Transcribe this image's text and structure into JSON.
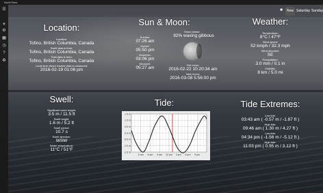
{
  "window": {
    "title": "NorthTides"
  },
  "nav": {
    "icons": [
      "menu-icon",
      "sun-icon",
      "settings-icon",
      "calendar-icon",
      "clock-icon",
      "help-icon",
      "share-icon"
    ],
    "glyphs": [
      "☰",
      "☀",
      "⚙",
      "▦",
      "◷",
      "?",
      "♻"
    ]
  },
  "toolbar": {
    "stop_glyph": "■",
    "days": [
      {
        "label": "Now",
        "active": true
      },
      {
        "label": "Saturday",
        "active": false
      },
      {
        "label": "Sunday",
        "active": false
      }
    ]
  },
  "location": {
    "heading": "Location:",
    "location_label": "Location:",
    "location_value": "Tofino, British Columbia, Canada",
    "swell_from_label": "Swell data is from:",
    "swell_from_value": "Tofino, British Columbia, Canada",
    "tide_from_label": "Tidal data is from:",
    "tide_from_value": "Tofino, British Columbia, Canada",
    "measured_label": "Local time where marine data is measured:",
    "measured_value": "2016-02-19 01:06 pm"
  },
  "sunmoon": {
    "heading": "Sun & Moon:",
    "sunrise_label": "Sunrise:",
    "sunrise_value": "07:26 am",
    "sunset_label": "Sunset:",
    "sunset_value": "05:50 pm",
    "moonrise_label": "Moonrise:",
    "moonrise_value": "03:06 pm",
    "moonset_label": "Moonset:",
    "moonset_value": "05:27 am",
    "phase_label": "Moon phase:",
    "phase_value": "92%  waxing gibbous",
    "fullmoon_label": "Full moon:",
    "fullmoon_value": "2016-02-22 10:20:34 am",
    "newmoon_label": "New moon:",
    "newmoon_value": "2016-03-08 5:56:00 pm"
  },
  "weather": {
    "heading": "Weather:",
    "temp_label": "Temperature:",
    "temp_value": "8°C / 47°F",
    "wind_speed_label": "Wind speed:",
    "wind_speed_value": "52 kmph / 32.3 mph",
    "wind_dir_label": "Wind direction:",
    "wind_dir_value": "SE",
    "precip_label": "Precipitation:",
    "precip_value": "3.0 mm / 0.1 in",
    "visibility_label": "Visibility:",
    "visibility_value": "8 km / 5.0 mi"
  },
  "swell": {
    "heading": "Swell:",
    "wave_label": "Significant wave height:",
    "wave_value": "3.5 m / 11.5 ft",
    "height_label": "Swell height:",
    "height_value": "1.6 m / 5.2 ft",
    "period_label": "Swell period:",
    "period_value": "10.7 s",
    "direction_label": "Swell direction:",
    "direction_value": "WSW",
    "water_label": "Water temperature:",
    "water_value": "11°C / 51°F"
  },
  "tide": {
    "heading": "Tide:"
  },
  "chart_data": {
    "type": "line",
    "title": "Tide:",
    "xlabel": "",
    "ylabel": "",
    "ytick_labels": [
      "1.5 m",
      "1.0 m",
      "0.5 m",
      "0.0 m",
      "-0.5 m",
      "-1.0 m",
      "-1.5 m"
    ],
    "ylim": [
      -1.5,
      1.5
    ],
    "xtick_labels": [
      "3 am",
      "6 am",
      "9 am",
      "12 pm",
      "3 pm",
      "6 pm",
      "9 pm"
    ],
    "x_hours": [
      0,
      3,
      6,
      9,
      12,
      15,
      18,
      21,
      24
    ],
    "series": [
      {
        "values_hours": [
          0,
          1.5,
          3.7,
          5.5,
          7.5,
          9.8,
          12,
          14.5,
          16.5,
          18.5,
          20.5,
          23,
          24
        ],
        "values": [
          0.2,
          -0.8,
          -1.5,
          -0.7,
          0.6,
          1.34,
          0.4,
          -1.1,
          -1.56,
          -1.0,
          0.2,
          1.3,
          1.1
        ]
      }
    ],
    "now_hour": 13.1,
    "grid": true
  },
  "extremes": {
    "heading": "Tide Extremes:",
    "items": [
      {
        "label": "Low tide:",
        "value": "03:43 am  ( -0.57 m / -1.87 ft )"
      },
      {
        "label": "High tide:",
        "value": "09:46 am  ( 1.30 m / 4.27 ft )"
      },
      {
        "label": "Low tide:",
        "value": "04:34 pm  ( -1.56 m / -5.12 ft )"
      },
      {
        "label": "High tide:",
        "value": "11:03 pm  ( 0.95 m / 3.12 ft )"
      }
    ]
  }
}
